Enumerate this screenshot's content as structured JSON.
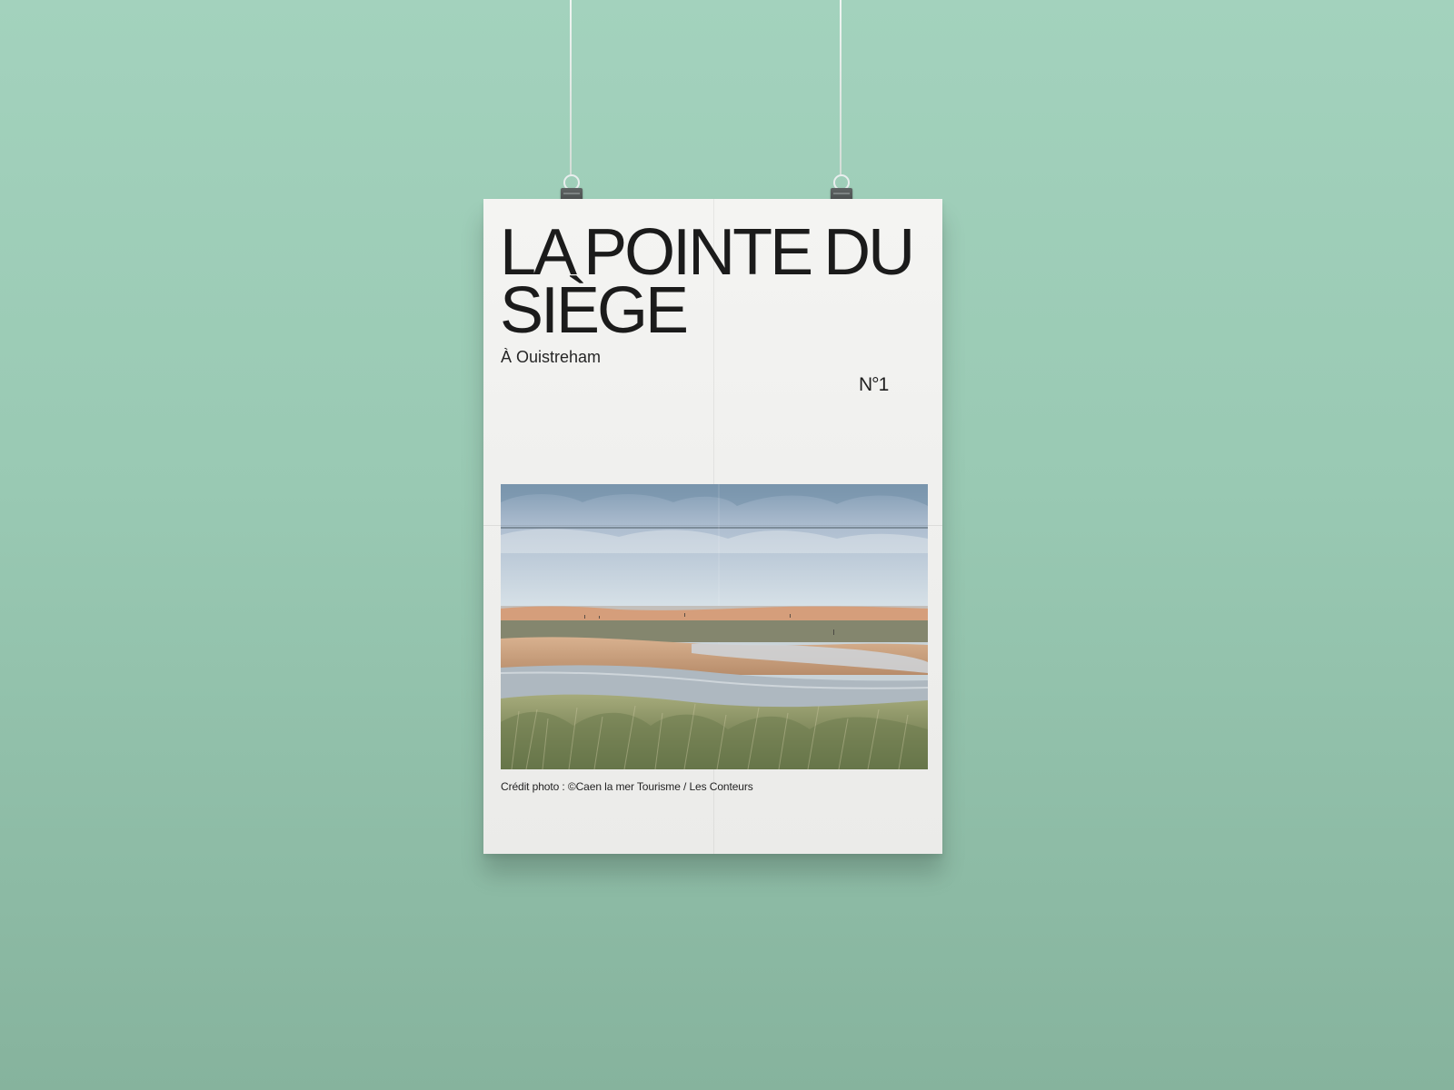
{
  "poster": {
    "title": "LA POINTE DU SIÈGE",
    "subtitle": "À Ouistreham",
    "number": "N°1",
    "credit": "Crédit photo : ©Caen la mer Tourisme / Les Conteurs"
  },
  "colors": {
    "wall": "#a3d2bd",
    "poster_paper": "#f0f0ee",
    "text": "#1b1b1b",
    "clip": "#4b5050"
  },
  "icons": {
    "left_clip": "binder-clip-icon",
    "right_clip": "binder-clip-icon"
  }
}
